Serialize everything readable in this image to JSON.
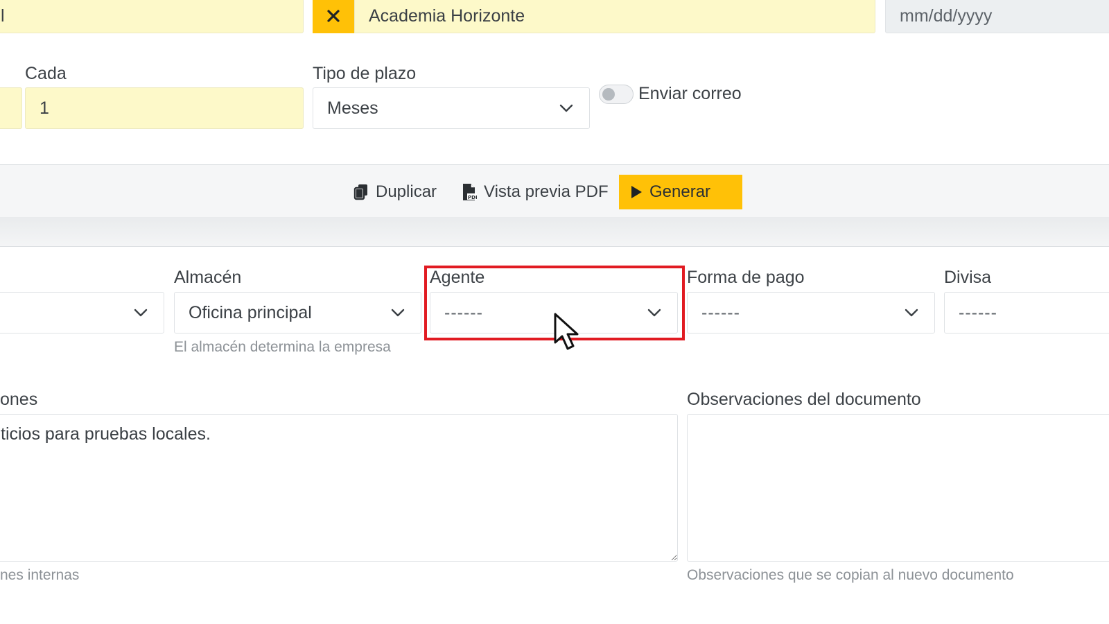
{
  "top_row": {
    "left_field_value": "l",
    "customer_value": "Academia Horizonte",
    "date_placeholder": "mm/dd/yyyy"
  },
  "schedule": {
    "every_label": "Cada",
    "every_value": "1",
    "term_type_label": "Tipo de plazo",
    "term_type_value": "Meses",
    "send_email_label": "Enviar correo"
  },
  "toolbar": {
    "duplicate_label": "Duplicar",
    "pdf_preview_label": "Vista previa PDF",
    "generate_label": "Generar"
  },
  "form": {
    "warehouse_label": "Almacén",
    "warehouse_value": "Oficina principal",
    "warehouse_help": "El almacén determina la empresa",
    "agent_label": "Agente",
    "agent_value": "------",
    "payment_label": "Forma de pago",
    "payment_value": "------",
    "currency_label": "Divisa",
    "currency_value": "------"
  },
  "notes": {
    "internal_label_fragment": "ones",
    "internal_text": "ticios para pruebas locales.",
    "internal_help_fragment": "nes internas",
    "doc_label": "Observaciones del documento",
    "doc_text": "",
    "doc_help": "Observaciones que se copian al nuevo documento"
  },
  "colors": {
    "accent": "#ffc107",
    "highlight": "#e11b22",
    "field_yellow": "#fdf9c9"
  }
}
